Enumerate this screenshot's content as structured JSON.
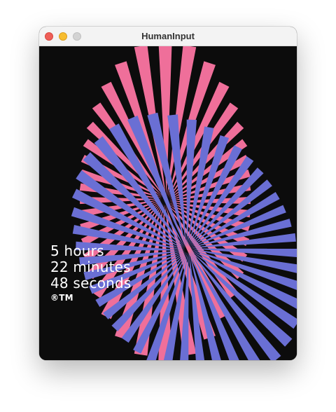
{
  "window": {
    "title": "HumanInput"
  },
  "artwork": {
    "background_color": "#0c0c0c",
    "pink_color": "#ef6f9a",
    "purple_color": "#6a6fd4"
  },
  "timer": {
    "hours": "5 hours",
    "minutes": "22 minutes",
    "seconds": "48 seconds",
    "mark": "®TM"
  }
}
